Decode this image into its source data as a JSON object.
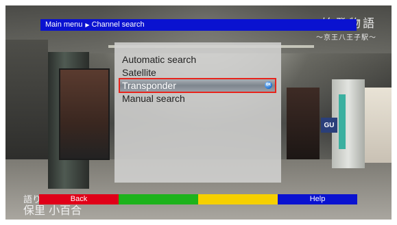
{
  "breadcrumb": {
    "root": "Main menu",
    "separator": "▶",
    "current": "Channel search"
  },
  "menu": {
    "items": [
      {
        "label": "Automatic search"
      },
      {
        "label": "Satellite"
      },
      {
        "label": "Transponder"
      },
      {
        "label": "Manual search"
      }
    ],
    "selected_index": 2,
    "ok_icon": "ok-button-icon"
  },
  "function_bar": {
    "red": "Back",
    "green": "",
    "yellow": "",
    "blue": "Help"
  },
  "overlay": {
    "title": "始発物語",
    "subtitle": "〜京王八王子駅〜",
    "bottom_line1": "語り",
    "bottom_line2": "保里 小百合",
    "sign": "GU"
  },
  "colors": {
    "breadcrumb_bg": "#0a12d0",
    "selection_border": "#e8231a",
    "red": "#e00018",
    "green": "#1db31c",
    "yellow": "#f6d000",
    "blue": "#0a12d0"
  }
}
